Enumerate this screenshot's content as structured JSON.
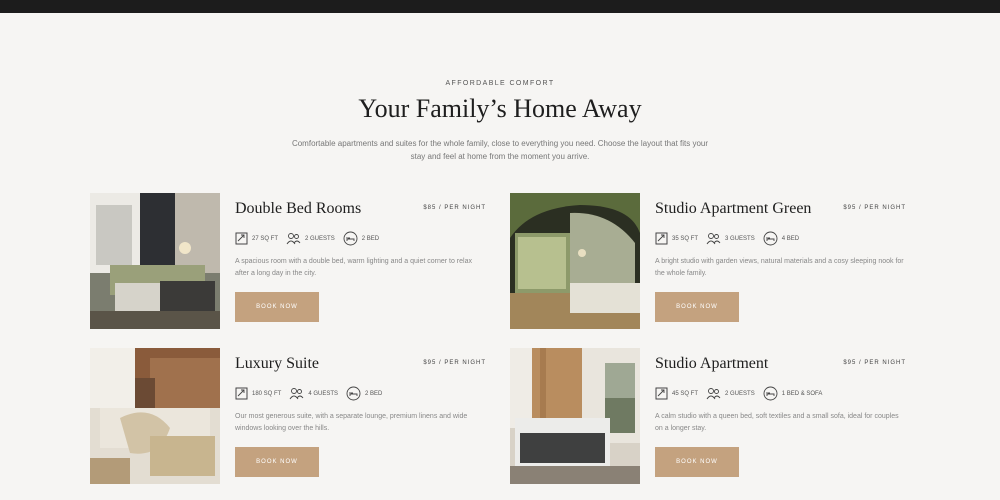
{
  "section": {
    "eyebrow": "AFFORDABLE COMFORT",
    "heading": "Your Family’s Home Away",
    "intro": "Comfortable apartments and suites for the whole family, close to everything you need. Choose the layout that fits your stay and feel at home from the moment you arrive."
  },
  "rooms": [
    {
      "title": "Double Bed Rooms",
      "price": "$85 / PER NIGHT",
      "features": [
        {
          "icon": "area-icon",
          "label": "27 SQ FT"
        },
        {
          "icon": "guests-icon",
          "label": "2 GUESTS"
        },
        {
          "icon": "bed-icon",
          "label": "2 BED"
        }
      ],
      "description": "A spacious room with a double bed, warm lighting and a quiet corner to relax after a long day in the city.",
      "button": "BOOK NOW"
    },
    {
      "title": "Studio Apartment Green",
      "price": "$95 / PER NIGHT",
      "features": [
        {
          "icon": "area-icon",
          "label": "35 SQ FT"
        },
        {
          "icon": "guests-icon",
          "label": "3 GUESTS"
        },
        {
          "icon": "bed-icon",
          "label": "4 BED"
        }
      ],
      "description": "A bright studio with garden views, natural materials and a cosy sleeping nook for the whole family.",
      "button": "BOOK NOW"
    },
    {
      "title": "Luxury Suite",
      "price": "$95 / PER NIGHT",
      "features": [
        {
          "icon": "area-icon",
          "label": "180 SQ FT"
        },
        {
          "icon": "guests-icon",
          "label": "4 GUESTS"
        },
        {
          "icon": "bed-icon",
          "label": "2 BED"
        }
      ],
      "description": "Our most generous suite, with a separate lounge, premium linens and wide windows looking over the hills.",
      "button": "BOOK NOW"
    },
    {
      "title": "Studio Apartment",
      "price": "$95 / PER NIGHT",
      "features": [
        {
          "icon": "area-icon",
          "label": "45 SQ FT"
        },
        {
          "icon": "guests-icon",
          "label": "2 GUESTS"
        },
        {
          "icon": "bed-icon",
          "label": "1 BED & SOFA"
        }
      ],
      "description": "A calm studio with a queen bed, soft textiles and a small sofa, ideal for couples on a longer stay.",
      "button": "BOOK NOW"
    }
  ]
}
